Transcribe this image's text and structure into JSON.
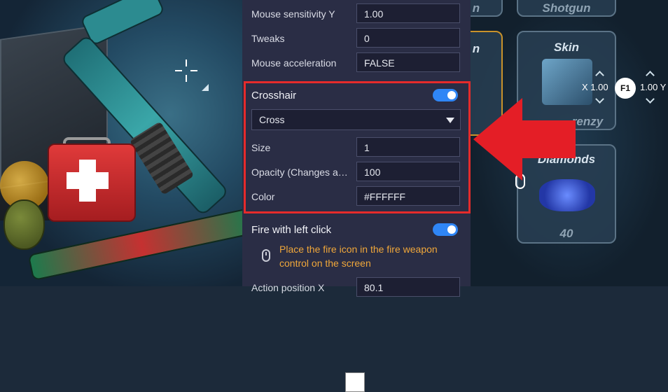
{
  "settings": {
    "rows_top": [
      {
        "label": "Mouse sensitivity Y",
        "value": "1.00"
      },
      {
        "label": "Tweaks",
        "value": "0"
      },
      {
        "label": "Mouse acceleration",
        "value": "FALSE"
      }
    ],
    "crosshair": {
      "title": "Crosshair",
      "enabled": true,
      "style_selected": "Cross",
      "size_label": "Size",
      "size_value": "1",
      "opacity_label": "Opacity (Changes ap...",
      "opacity_value": "100",
      "color_label": "Color",
      "color_value": "#FFFFFF",
      "highlight_color": "#E52B2B"
    },
    "fire": {
      "title": "Fire with left click",
      "enabled": true,
      "hint": "Place the fire icon in the fire weapon control on the screen",
      "next_label": "Action position X",
      "next_value": "80.1"
    }
  },
  "game": {
    "tile_top_left_label": "n",
    "tile_shotgun_label": "Shotgun",
    "tile_skin_label": "Skin",
    "tile_skin_sub": "renzy",
    "tile_diamonds_label": "Diamonds",
    "tile_diamonds_value": "40",
    "tile_mid_left_label": "n",
    "key_label": "F1",
    "scale_left": "X 1.00",
    "scale_right": "1.00 Y"
  },
  "colors": {
    "accent_toggle": "#2F86F6",
    "hint_text": "#F0A73A",
    "arrow": "#E41E26"
  }
}
